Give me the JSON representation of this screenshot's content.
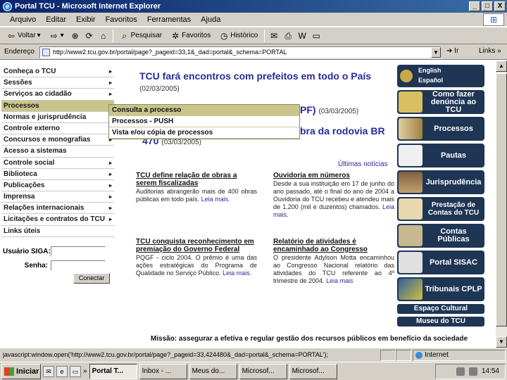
{
  "window": {
    "title": "Portal TCU - Microsoft Internet Explorer",
    "buttons": [
      "_",
      "□",
      "X"
    ]
  },
  "menubar": [
    "Arquivo",
    "Editar",
    "Exibir",
    "Favoritos",
    "Ferramentas",
    "Ajuda"
  ],
  "toolbar": {
    "back": "Voltar",
    "search": "Pesquisar",
    "favorites": "Favoritos",
    "history": "Histórico"
  },
  "address": {
    "label": "Endereço",
    "url": "http://www2.tcu.gov.br/portal/page?_pageid=33,1&_dad=portal&_schema=PORTAL",
    "go": "Ir",
    "links": "Links »"
  },
  "nav": {
    "items": [
      {
        "label": "Conheça o TCU",
        "arrow": "▸"
      },
      {
        "label": "Sessões",
        "arrow": "▸"
      },
      {
        "label": "Serviços ao cidadão",
        "arrow": "▸"
      },
      {
        "label": "Processos",
        "arrow": "▸"
      },
      {
        "label": "Normas e jurisprudência",
        "arrow": ""
      },
      {
        "label": "Controle externo",
        "arrow": ""
      },
      {
        "label": "Concursos e monografias",
        "arrow": "▸"
      },
      {
        "label": "Acesso a sistemas",
        "arrow": ""
      },
      {
        "label": "Controle social",
        "arrow": "▸"
      },
      {
        "label": "Biblioteca",
        "arrow": "▸"
      },
      {
        "label": "Publicações",
        "arrow": "▸"
      },
      {
        "label": "Imprensa",
        "arrow": "▸"
      },
      {
        "label": "Relações internacionais",
        "arrow": "▸"
      },
      {
        "label": "Licitações e contratos do TCU",
        "arrow": "▸"
      },
      {
        "label": "Links úteis",
        "arrow": ""
      }
    ],
    "submenu": [
      "Consulta a processo",
      "Processos - PUSH",
      "Vista e/ou cópia de processos"
    ]
  },
  "login": {
    "user_label": "Usuário SIGA:",
    "password_label": "Senha:",
    "button": "Conectar"
  },
  "headlines": {
    "h1_title": "TCU fará encontros com prefeitos em todo o País",
    "h1_date": "(02/03/2005)",
    "h2_tail": "PF)",
    "h2_date": "(03/03/2005)",
    "h3_tail": "bra da rodovia BR",
    "h3_line2": "470",
    "h3_date": "(03/03/2005)",
    "more": "Últimas notícias"
  },
  "articles": [
    {
      "title": "TCU define relação de obras a serem fiscalizadas",
      "body": "Auditorias abrangerão mais de 400 obras públicas em todo país",
      "link": "Leia mais."
    },
    {
      "title": "Ouvidoria em números",
      "body": "Desde a sua instituição em 17 de junho do ano passado, até o final do ano de 2004 a Ouvidoria do TCU recebeu e atendeu mais de 1.200 (mil e duzentos) chamados",
      "link": "Leia mais."
    },
    {
      "title": "TCU conquista reconhecimento em premiação do Governo Federal",
      "body": "PQGF - ciclo 2004. O prêmio é uma das ações estratégicas do Programa de Qualidade no Serviço Público.",
      "link": "Leia mais."
    },
    {
      "title": "Relatório de atividades é encaminhado ao Congresso",
      "body": "O presidente Adylson Motta encaminhou ao Congresso Nacional relatório das atividades do TCU referente ao 4º trimestre de 2004.",
      "link": "Leia mais"
    }
  ],
  "mission": "Missão: assegurar a efetiva e regular gestão dos recursos públicos em benefício da sociedade",
  "right": {
    "lang1": "English",
    "lang2": "Español",
    "banners": [
      "Como fazer denúncia ao TCU",
      "Processos",
      "Pautas",
      "Jurisprudência",
      "Prestação de Contas do TCU",
      "Contas Públicas",
      "Portal SISAC",
      "Tribunais CPLP"
    ],
    "slim": [
      "Espaço Cultural",
      "Museu do TCU"
    ]
  },
  "status": {
    "text": "javascript:window.open('http://www2.tcu.gov.br/portal/page?_pageid=33,424480&_dad=portal&_schema=PORTAL');",
    "zone": "Internet"
  },
  "taskbar": {
    "start": "Iniciar",
    "tasks": [
      "Portal T...",
      "Inbox - ...",
      "Meus do...",
      "Microsof...",
      "Microsof..."
    ],
    "clock": "14:54"
  },
  "colors": {
    "highlight": "#c9c48a",
    "banner": "#1f3554",
    "link": "#2a2a9a"
  }
}
